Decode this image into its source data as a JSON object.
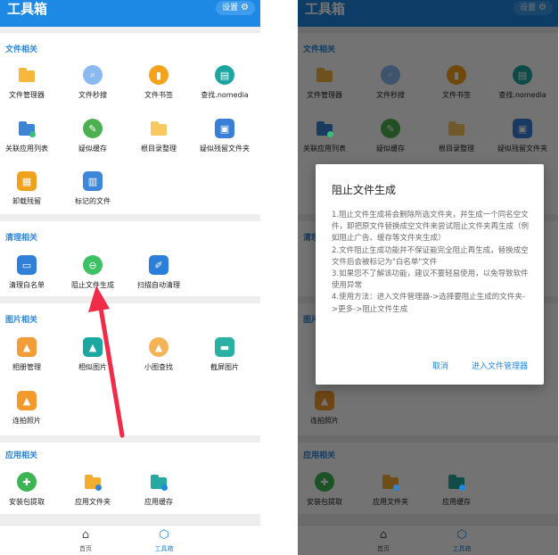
{
  "app": {
    "title": "工具箱",
    "settings_label": "设置"
  },
  "sections": {
    "file": {
      "title": "文件相关",
      "items": [
        "文件管理器",
        "文件秒搜",
        "文件书签",
        "查找.nomedia",
        "关联应用列表",
        "疑似缓存",
        "根目录整理",
        "疑似残留文件夹",
        "卸载残留",
        "标记的文件"
      ]
    },
    "clean": {
      "title": "清理相关",
      "items": [
        "清理白名单",
        "阻止文件生成",
        "扫描自动清理"
      ]
    },
    "image": {
      "title": "图片相关",
      "items": [
        "相册管理",
        "相似图片",
        "小图查找",
        "截屏图片",
        "连拍照片"
      ]
    },
    "app_rel": {
      "title": "应用相关",
      "items": [
        "安装包提取",
        "应用文件夹",
        "应用缓存"
      ]
    }
  },
  "nav": {
    "home": "首页",
    "tools": "工具箱"
  },
  "dialog": {
    "title": "阻止文件生成",
    "lines": [
      "1.阻止文件生成将会删除所选文件夹，并生成一个同名空文件，即把原文件替换成空文件来尝试阻止文件夹再生成（例如阻止广告、缓存等文件夹生成）",
      "2.文件阻止生成功能并不保证能完全阻止再生成，替换成空文件后会被标记为\"白名单\"文件",
      "3.如果您不了解该功能，建议不要轻易使用，以免导致软件使用异常",
      "4.使用方法：进入文件管理器->选择要阻止生成的文件夹->更多->阻止文件生成"
    ],
    "cancel": "取消",
    "goto": "进入文件管理器"
  },
  "colors": {
    "primary": "#1e88e5",
    "section_title": "#2d86d8",
    "annotation_arrow": "#f02c48"
  },
  "icons": [
    "folder-icon",
    "search-icon",
    "bookmark-icon",
    "media-scan-icon",
    "link-apps-icon",
    "cache-icon",
    "root-folder-icon",
    "residual-folder-icon",
    "uninstall-icon",
    "marked-files-icon",
    "whitelist-icon",
    "block-icon",
    "broom-icon",
    "image-icon",
    "photo-icon",
    "small-image-icon",
    "screenshot-icon",
    "burst-photo-icon",
    "android-icon",
    "app-folder-icon",
    "app-cache-icon",
    "home-icon",
    "cube-icon",
    "gear-icon"
  ]
}
